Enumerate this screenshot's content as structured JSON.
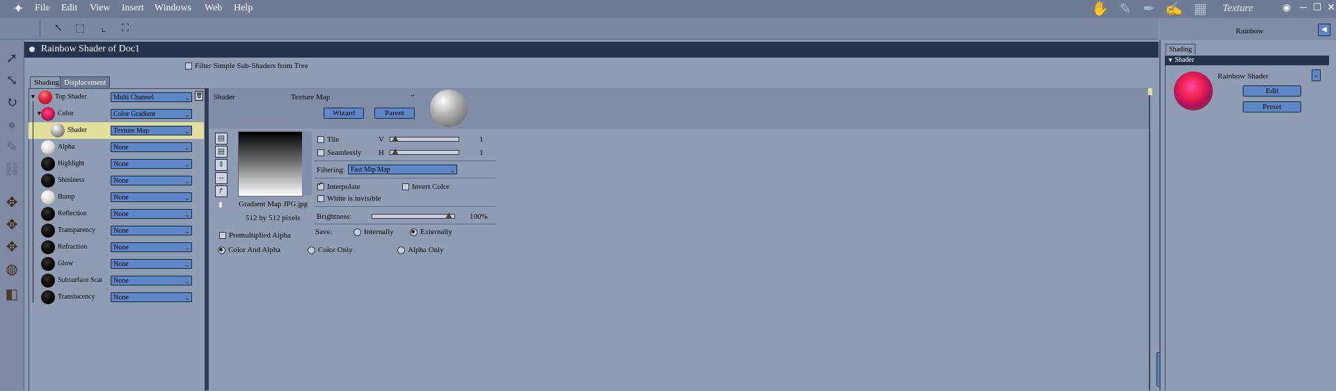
{
  "menu": {
    "items": [
      "File",
      "Edit",
      "View",
      "Insert",
      "Windows",
      "Web",
      "Help"
    ]
  },
  "room": {
    "title": "Texture"
  },
  "panel": {
    "title": "Rainbow Shader of Doc1",
    "filter_label": "Filter Simple Sub-Shaders from Tree",
    "tabs": [
      "Shading",
      "Displacement"
    ]
  },
  "tree": {
    "rows": [
      {
        "label": "Top Shader",
        "value": "Multi Channel",
        "ball": "red"
      },
      {
        "label": "Color",
        "value": "Color Gradient",
        "ball": "rainbow"
      },
      {
        "label": "Shader",
        "value": "Texture Map",
        "ball": "grey"
      },
      {
        "label": "Alpha",
        "value": "None",
        "ball": "white"
      },
      {
        "label": "Highlight",
        "value": "None",
        "ball": "black"
      },
      {
        "label": "Shininess",
        "value": "None",
        "ball": "black"
      },
      {
        "label": "Bump",
        "value": "None",
        "ball": "white"
      },
      {
        "label": "Reflection",
        "value": "None",
        "ball": "black"
      },
      {
        "label": "Transparency",
        "value": "None",
        "ball": "black"
      },
      {
        "label": "Refraction",
        "value": "None",
        "ball": "black"
      },
      {
        "label": "Glow",
        "value": "None",
        "ball": "black"
      },
      {
        "label": "Subsurface Scat",
        "value": "None",
        "ball": "black"
      },
      {
        "label": "Translucency",
        "value": "None",
        "ball": "black"
      }
    ]
  },
  "editor": {
    "shader_label": "Shader",
    "shader_type": "Texture Map",
    "wizard": "Wizard",
    "parent": "Parent",
    "image_name": "Gradient Map JPG.jpg",
    "image_size": "512 by 512 pixels",
    "tile": "Tile",
    "seamlessly": "Seamlessly",
    "v_label": "V",
    "h_label": "H",
    "v_value": "1",
    "h_value": "1",
    "filtering_label": "Filtering:",
    "filtering_value": "Fast Mip Map",
    "interpolate": "Interpolate",
    "invert_color": "Invert Color",
    "white_invisible": "White is invisible",
    "brightness_label": "Brightness:",
    "brightness_value": "100%",
    "premultiplied": "Premultiplied Alpha",
    "save_label": "Save:",
    "internally": "Internally",
    "externally": "Externally",
    "color_and_alpha": "Color And Alpha",
    "color_only": "Color Only",
    "alpha_only": "Alpha Only"
  },
  "right_panel": {
    "title": "Rainbow",
    "tab": "Shading",
    "section": "Shader",
    "shader_name": "Rainbow Shader",
    "edit": "Edit",
    "preset": "Preset"
  }
}
